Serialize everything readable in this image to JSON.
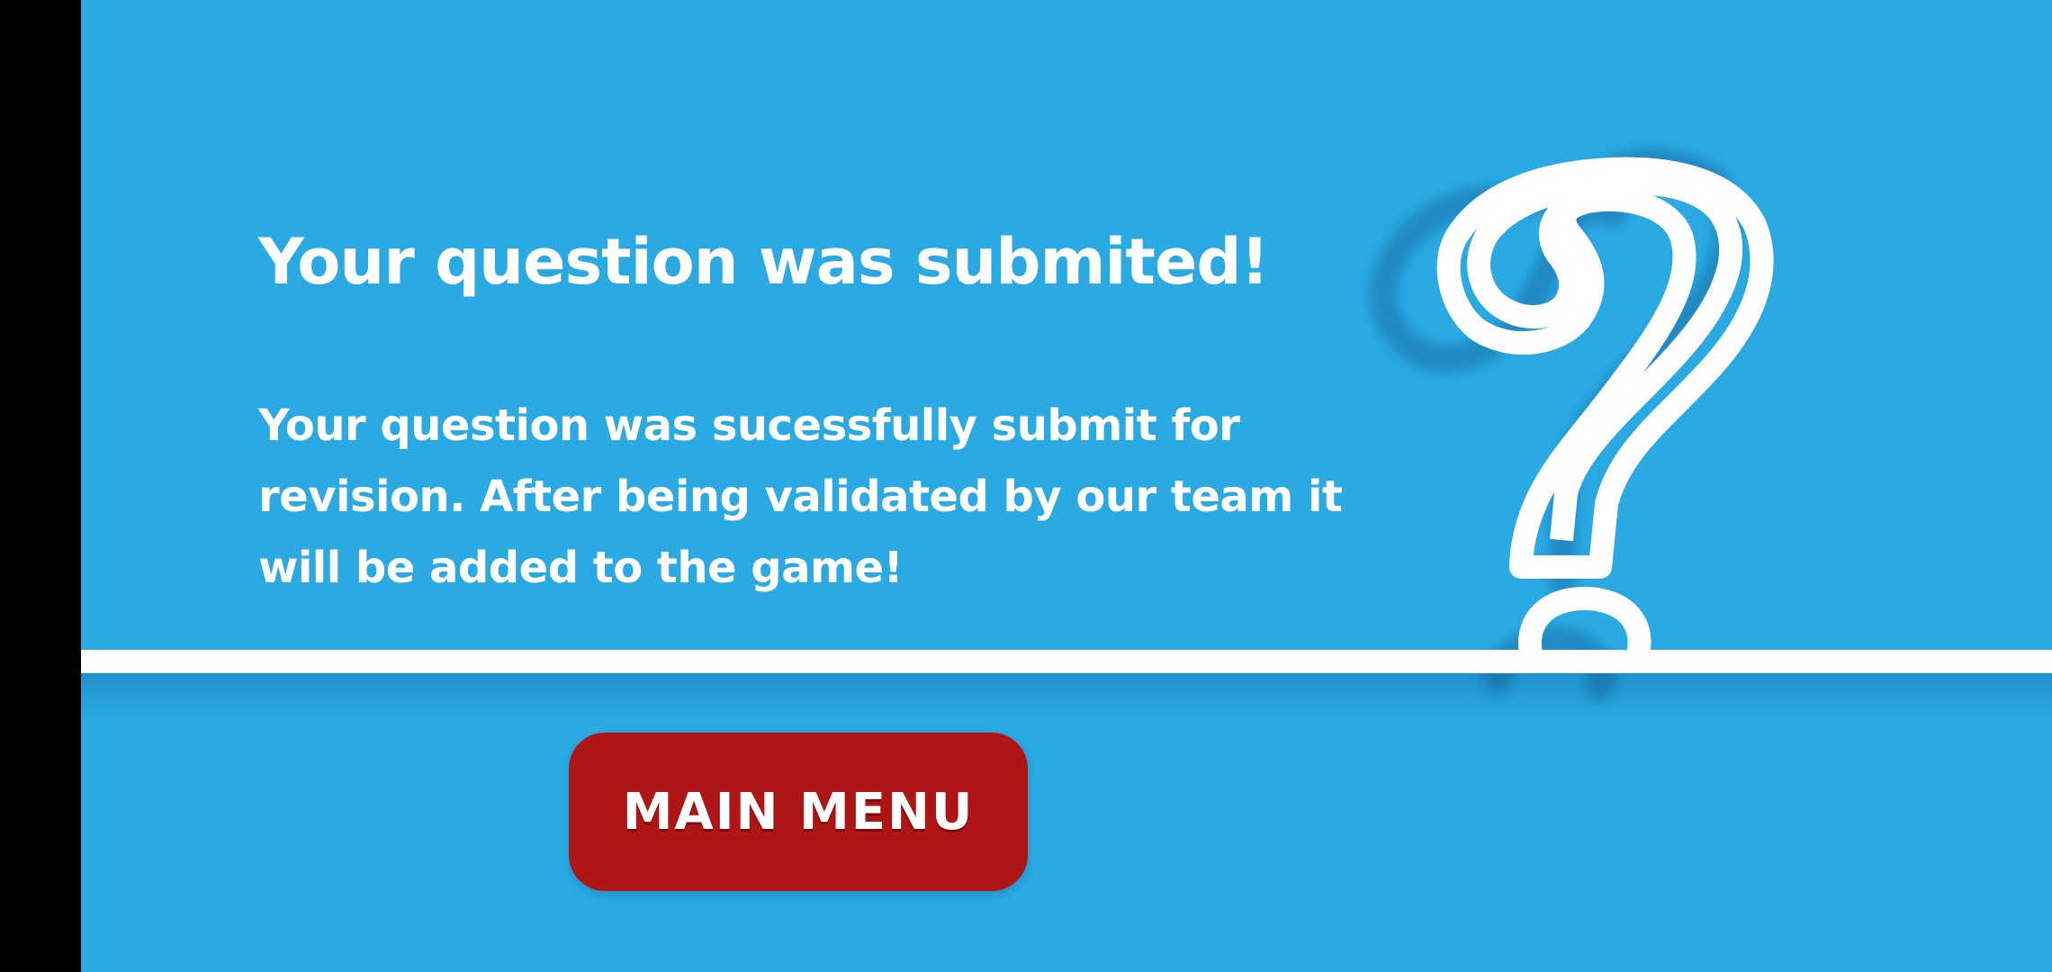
{
  "screen": {
    "background_color": "#2aa9e3",
    "accent_color": "#ffffff",
    "button_color": "#b01515"
  },
  "dialog": {
    "title": "Your question was submited!",
    "message": "Your question was sucessfully submit for revision. After being validated by our team it will be added to the game!"
  },
  "actions": {
    "main_menu_label": "MAIN MENU"
  },
  "decoration": {
    "icon": "question-mark-icon"
  }
}
